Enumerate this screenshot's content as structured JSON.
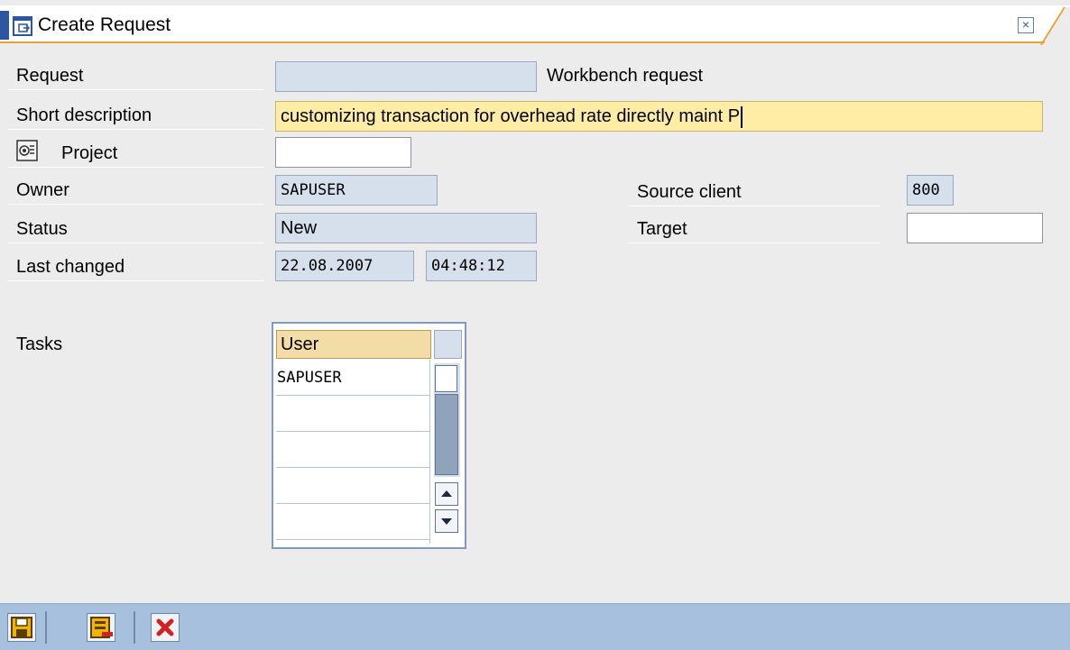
{
  "window": {
    "title": "Create Request",
    "close_glyph": "×"
  },
  "form": {
    "request": {
      "label": "Request",
      "value": "",
      "type_text": "Workbench request"
    },
    "short_description": {
      "label": "Short description",
      "value": "customizing transaction for overhead rate directly maint P"
    },
    "project": {
      "label": "Project",
      "value": ""
    },
    "owner": {
      "label": "Owner",
      "value": "SAPUSER"
    },
    "status": {
      "label": "Status",
      "value": "New"
    },
    "last_changed": {
      "label": "Last changed",
      "date": "22.08.2007",
      "time": "04:48:12"
    },
    "source_client": {
      "label": "Source client",
      "value": "800"
    },
    "target": {
      "label": "Target",
      "value": ""
    }
  },
  "tasks": {
    "label": "Tasks",
    "column_header": "User",
    "rows": [
      "SAPUSER",
      "",
      "",
      "",
      ""
    ]
  },
  "toolbar": {
    "buttons": [
      {
        "name": "save-button",
        "icon": "save-icon"
      },
      {
        "name": "own-requests-button",
        "icon": "own-requests-icon"
      },
      {
        "name": "cancel-button",
        "icon": "cancel-icon"
      }
    ]
  },
  "colors": {
    "field_readonly": "#d5e0ec",
    "field_focus": "#ffeda6",
    "toolbar": "#a6c0dd",
    "table_header": "#f4dca6",
    "cancel_red": "#d42020"
  }
}
